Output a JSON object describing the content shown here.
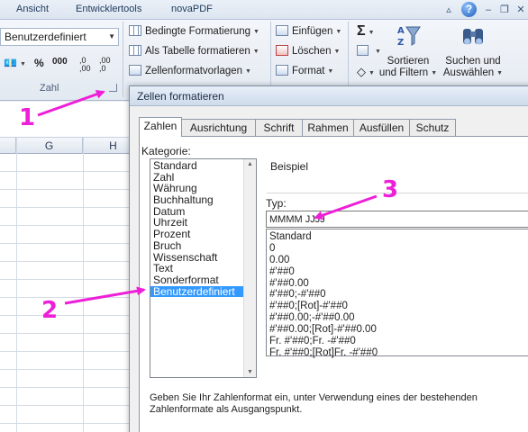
{
  "ribbon": {
    "tabs": [
      "Ansicht",
      "Entwicklertools",
      "novaPDF"
    ],
    "window_controls": {
      "help": "?"
    },
    "number_format": {
      "value": "Benutzerdefiniert"
    },
    "number_buttons": [
      "%",
      "000",
      ",0 ,00",
      ",00 ,0"
    ],
    "group_label": "Zahl",
    "styles": {
      "conditional": "Bedingte Formatierung",
      "as_table": "Als Tabelle formatieren",
      "cell_styles": "Zellenformatvorlagen"
    },
    "cells": {
      "insert": "Einfügen",
      "delete": "Löschen",
      "format": "Format"
    },
    "editing": {
      "sort_filter": [
        "Sortieren",
        "und Filtern"
      ],
      "find_select": [
        "Suchen und",
        "Auswählen"
      ]
    }
  },
  "sheet": {
    "columns": [
      "G",
      "H"
    ]
  },
  "dialog": {
    "title": "Zellen formatieren",
    "tabs": [
      "Zahlen",
      "Ausrichtung",
      "Schrift",
      "Rahmen",
      "Ausfüllen",
      "Schutz"
    ],
    "active_tab": "Zahlen",
    "category_label": "Kategorie:",
    "categories": [
      "Standard",
      "Zahl",
      "Währung",
      "Buchhaltung",
      "Datum",
      "Uhrzeit",
      "Prozent",
      "Bruch",
      "Wissenschaft",
      "Text",
      "Sonderformat",
      "Benutzerdefiniert"
    ],
    "selected_category": "Benutzerdefiniert",
    "example_label": "Beispiel",
    "type_label": "Typ:",
    "type_value": "MMMM JJJJ",
    "type_list": [
      "Standard",
      "0",
      "0.00",
      "#'##0",
      "#'##0.00",
      "#'##0;-#'##0",
      "#'##0;[Rot]-#'##0",
      "#'##0.00;-#'##0.00",
      "#'##0.00;[Rot]-#'##0.00",
      "Fr. #'##0;Fr. -#'##0",
      "Fr. #'##0;[Rot]Fr. -#'##0"
    ],
    "hint": "Geben Sie Ihr Zahlenformat ein, unter Verwendung eines der bestehenden Zahlenformate als Ausgangspunkt."
  },
  "annotations": {
    "labels": [
      "1",
      "2",
      "3"
    ],
    "color": "#ee1fd8"
  }
}
